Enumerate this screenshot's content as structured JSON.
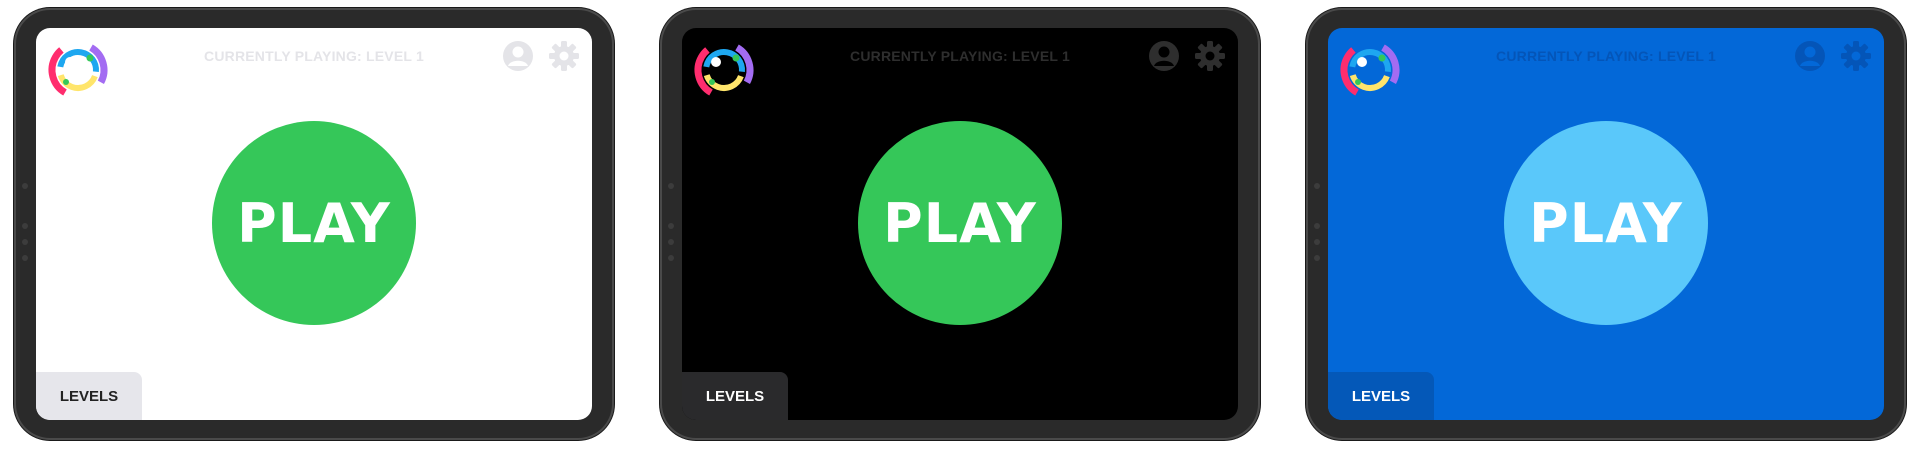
{
  "variants": [
    {
      "theme": "light",
      "status_text": "CURRENTLY PLAYING: LEVEL 1",
      "play_label": "PLAY",
      "levels_label": "LEVELS",
      "colors": {
        "screen": "#ffffff",
        "status": "#e4e4e8",
        "icons": "#e4e4e8",
        "play": "#35c759",
        "levels_bg": "#e6e6eb",
        "levels_text": "#222222",
        "logo_inner": "#ffffff"
      }
    },
    {
      "theme": "dark",
      "status_text": "CURRENTLY PLAYING: LEVEL 1",
      "play_label": "PLAY",
      "levels_label": "LEVELS",
      "colors": {
        "screen": "#000000",
        "status": "#2e2e2e",
        "icons": "#2e2e2e",
        "play": "#35c759",
        "levels_bg": "#2a2a2c",
        "levels_text": "#ffffff",
        "logo_inner": "#000000"
      }
    },
    {
      "theme": "blue",
      "status_text": "CURRENTLY PLAYING: LEVEL 1",
      "play_label": "PLAY",
      "levels_label": "LEVELS",
      "colors": {
        "screen": "#0368d8",
        "status": "#0455b8",
        "icons": "#0455b8",
        "play": "#5ac8fa",
        "levels_bg": "#0458b8",
        "levels_text": "#ffffff",
        "logo_inner": "#0368d8"
      }
    }
  ],
  "icons": {
    "logo": "rainbow-ring-logo-icon",
    "user": "user-account-icon",
    "settings": "gear-icon"
  }
}
